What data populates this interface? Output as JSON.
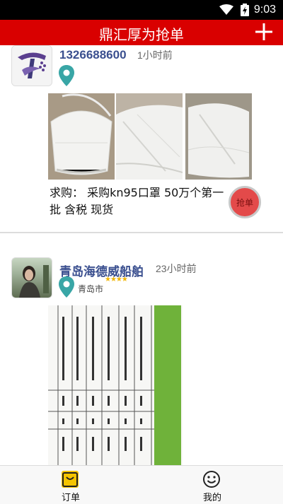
{
  "status_bar": {
    "time": "9:03"
  },
  "app_bar": {
    "title": "鼎汇厚为抢单"
  },
  "posts": [
    {
      "name": "1326688600",
      "time_ago": "1小时前",
      "request": "求购： 采购kn95口罩 50万个第一批 含税 现货",
      "grab_label": "抢单"
    },
    {
      "name": "青岛海德威船舶",
      "time_ago": "23小时前",
      "city": "青岛市",
      "stars": "★★★★"
    }
  ],
  "tab_bar": {
    "tabs": [
      {
        "label": "订单",
        "icon": "order-bag-icon"
      },
      {
        "label": "我的",
        "icon": "smiley-profile-icon"
      }
    ]
  },
  "colors": {
    "accent": "#d90000",
    "name_text": "#3a4f8f",
    "pin": "#39a6a6",
    "stars": "#f0b400",
    "grab_button": "#e34a4a",
    "tab_icon_active": "#f5c400"
  }
}
